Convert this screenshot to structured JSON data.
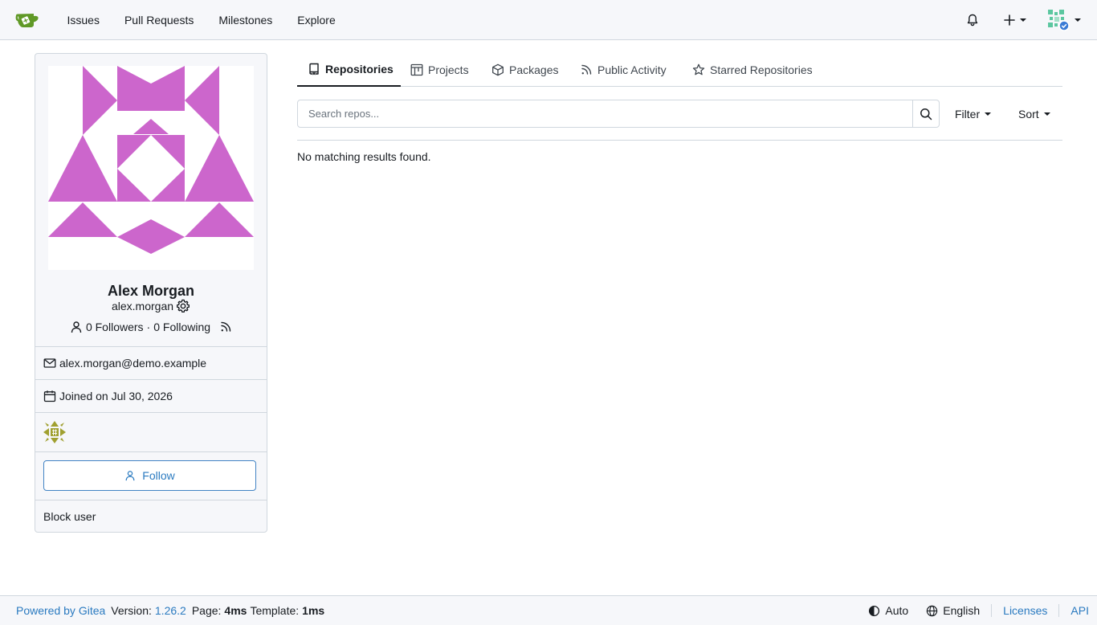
{
  "nav": {
    "links": [
      "Issues",
      "Pull Requests",
      "Milestones",
      "Explore"
    ],
    "brand_color": "#609926"
  },
  "profile": {
    "name": "Alex Morgan",
    "username": "alex.morgan",
    "followers": "0 Followers",
    "separator": "·",
    "following": "0 Following",
    "email": "alex.morgan@demo.example",
    "joined": "Joined on Jul 30, 2026",
    "follow_label": "Follow",
    "block_label": "Block user",
    "avatar_color": "#cc66cc"
  },
  "tabs": [
    {
      "label": "Repositories",
      "icon": "repo-icon",
      "active": true
    },
    {
      "label": "Projects",
      "icon": "project-icon",
      "active": false
    },
    {
      "label": "Packages",
      "icon": "package-icon",
      "active": false
    },
    {
      "label": "Public Activity",
      "icon": "rss-icon",
      "active": false
    },
    {
      "label": "Starred Repositories",
      "icon": "star-icon",
      "active": false
    }
  ],
  "search": {
    "placeholder": "Search repos...",
    "value": ""
  },
  "filter_label": "Filter",
  "sort_label": "Sort",
  "empty_message": "No matching results found.",
  "footer": {
    "powered": "Powered by Gitea",
    "version_label": "Version:",
    "version": "1.26.2",
    "page_label": "Page:",
    "page_time": "4ms",
    "template_label": "Template:",
    "template_time": "1ms",
    "theme": "Auto",
    "language": "English",
    "licenses": "Licenses",
    "api": "API"
  }
}
